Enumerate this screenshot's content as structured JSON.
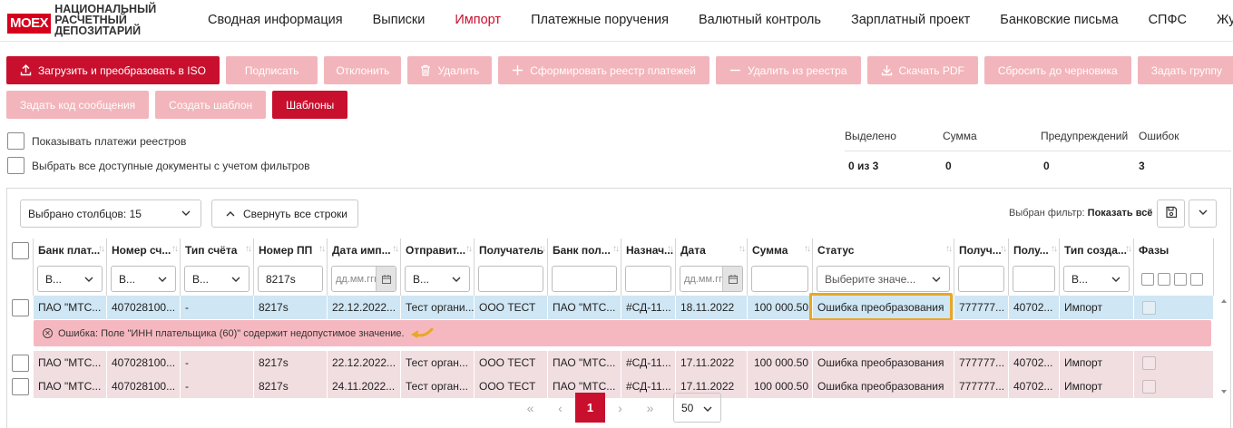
{
  "logo": {
    "badge": "MOEX",
    "line1": "НАЦИОНАЛЬНЫЙ",
    "line2": "РАСЧЕТНЫЙ",
    "line3": "ДЕПОЗИТАРИЙ"
  },
  "nav": [
    "Сводная информация",
    "Выписки",
    "Импорт",
    "Платежные поручения",
    "Валютный контроль",
    "Зарплатный проект",
    "Банковские письма",
    "СПФС",
    "Журнал"
  ],
  "nav_active": "Импорт",
  "toolbar": {
    "row1": [
      "Загрузить и преобразовать в ISO",
      "Подписать",
      "Отклонить",
      "Удалить",
      "Сформировать реестр платежей",
      "Удалить из реестра",
      "Скачать PDF",
      "Сбросить до черновика",
      "Задать группу"
    ],
    "row2": [
      "Задать код сообщения",
      "Создать шаблон",
      "Шаблоны"
    ]
  },
  "options": {
    "show_registry_payments": "Показывать платежи реестров",
    "select_all_filtered": "Выбрать все доступные документы с учетом фильтров"
  },
  "summary": {
    "headers": [
      "Выделено",
      "Сумма",
      "Предупреждений",
      "Ошибок"
    ],
    "values": [
      "0 из 3",
      "0",
      "0",
      "3"
    ]
  },
  "grid": {
    "columns_selected": "Выбрано столбцов: 15",
    "collapse_rows": "Свернуть все строки",
    "filter_label": "Выбран фильтр:",
    "filter_value": "Показать всё",
    "headers": [
      "Банк плат...",
      "Номер сч...",
      "Тип счёта",
      "Номер ПП",
      "Дата имп...",
      "Отправит...",
      "Получатель",
      "Банк пол...",
      "Назнач...",
      "Дата",
      "Сумма",
      "Статус",
      "Получ...",
      "Полу...",
      "Тип созда...",
      "Фазы"
    ],
    "filters": {
      "bank_payer": "В...",
      "account": "В...",
      "account_type": "В...",
      "pp_number": "8217s",
      "date_import_placeholder": "дд.мм.гггг",
      "sender": "В...",
      "date_placeholder": "дд.мм.гггг",
      "status_placeholder": "Выберите значе...",
      "creation_type": "В..."
    },
    "rows": [
      [
        "ПАО \"МТС...",
        "407028100...",
        "-",
        "8217s",
        "22.12.2022...",
        "Тест органи...",
        "ООО ТЕСТ",
        "ПАО \"МТС...",
        "#СД-11...",
        "18.11.2022",
        "100 000.50",
        "Ошибка преобразования",
        "777777...",
        "40702...",
        "Импорт"
      ],
      [
        "ПАО \"МТС...",
        "407028100...",
        "-",
        "8217s",
        "22.12.2022...",
        "Тест орган...",
        "ООО ТЕСТ",
        "ПАО \"МТС...",
        "#СД-11...",
        "17.11.2022",
        "100 000.50",
        "Ошибка преобразования",
        "777777...",
        "40702...",
        "Импорт"
      ],
      [
        "ПАО \"МТС...",
        "407028100...",
        "-",
        "8217s",
        "24.11.2022...",
        "Тест орган...",
        "ООО ТЕСТ",
        "ПАО \"МТС...",
        "#СД-11...",
        "17.11.2022",
        "100 000.50",
        "Ошибка преобразования",
        "777777...",
        "40702...",
        "Импорт"
      ]
    ],
    "error_message": "Ошибка: Поле \"ИНН плательщика (60)\" содержит недопустимое значение."
  },
  "pagination": {
    "current_page": "1",
    "page_size": "50"
  },
  "colors": {
    "accent": "#c8102e",
    "disabled": "#f2b5bb",
    "selected_row": "#cfe6f4",
    "error_row": "#f1dee1",
    "error_band": "#f6b8c0",
    "highlight": "#e8a825"
  }
}
